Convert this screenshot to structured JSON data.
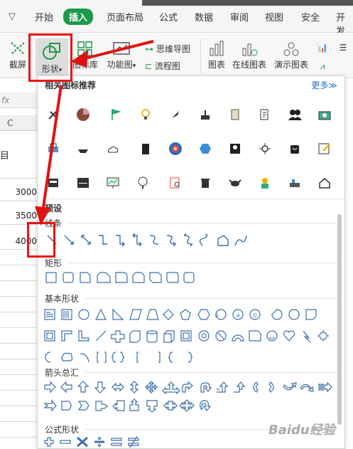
{
  "menubar": {
    "dropdown_glyph": "▽",
    "tabs": [
      "开始",
      "插入",
      "页面布局",
      "公式",
      "数据",
      "审阅",
      "视图",
      "安全",
      "开发"
    ],
    "active_tab": "插入",
    "accent": "#1a9a4a"
  },
  "ribbon": {
    "screenshot": "截屏",
    "shapes": "形状",
    "shapes_dd": "▾",
    "iconlib": "图标库",
    "funcchart": "功能图",
    "funcchart_dd": "▾",
    "mindmap": "思维导图",
    "flowchart": "流程图",
    "chart": "图表",
    "online_chart": "在线图表",
    "demo_chart": "演示图表"
  },
  "sheet": {
    "fx": "fx",
    "col": "C",
    "row_label": "目",
    "values": [
      "3000",
      "3500",
      "4000"
    ]
  },
  "popup": {
    "recommend_title": "相关图标推荐",
    "more": "更多≫",
    "preset": "预设",
    "lines": "线条",
    "rect": "矩形",
    "basic": "基本形状",
    "arrows": "箭头总汇",
    "formula": "公式形状",
    "circle_numbers": [
      "①",
      "⑩",
      "⑫"
    ]
  },
  "watermark": "Baidu经验",
  "colors": {
    "red": "#e11111",
    "shape_stroke": "#3d6fa8"
  }
}
